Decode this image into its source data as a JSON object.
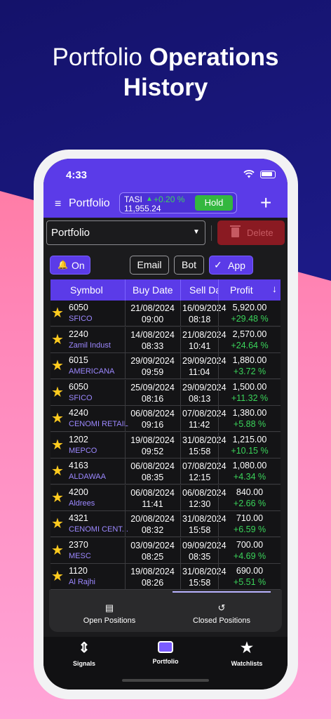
{
  "headline": {
    "light": "Portfolio",
    "bold1": "Operations",
    "bold2": "History"
  },
  "status": {
    "time": "4:33"
  },
  "appbar": {
    "title": "Portfolio",
    "tasi_name": "TASI",
    "tasi_change": "+0.20 %",
    "tasi_value": "11,955.24",
    "hold": "Hold"
  },
  "controls": {
    "portfolio_select": "Portfolio",
    "delete": "Delete",
    "on": "On",
    "email": "Email",
    "bot": "Bot",
    "app": "App"
  },
  "table": {
    "headers": [
      "Symbol",
      "Buy Date",
      "Sell Date",
      "Profit"
    ],
    "rows": [
      {
        "code": "6050",
        "name": "SFICO",
        "buy_date": "21/08/2024",
        "buy_time": "09:00",
        "sell_date": "16/09/2024",
        "sell_time": "08:18",
        "profit": "5,920.00",
        "pct": "+29.48 %"
      },
      {
        "code": "2240",
        "name": "Zamil Indust",
        "buy_date": "14/08/2024",
        "buy_time": "08:33",
        "sell_date": "21/08/2024",
        "sell_time": "10:41",
        "profit": "2,570.00",
        "pct": "+24.64 %"
      },
      {
        "code": "6015",
        "name": "AMERICANA",
        "buy_date": "29/09/2024",
        "buy_time": "09:59",
        "sell_date": "29/09/2024",
        "sell_time": "11:04",
        "profit": "1,880.00",
        "pct": "+3.72 %"
      },
      {
        "code": "6050",
        "name": "SFICO",
        "buy_date": "25/09/2024",
        "buy_time": "08:16",
        "sell_date": "29/09/2024",
        "sell_time": "08:13",
        "profit": "1,500.00",
        "pct": "+11.32 %"
      },
      {
        "code": "4240",
        "name": "CENOMI RETAIL",
        "buy_date": "06/08/2024",
        "buy_time": "09:16",
        "sell_date": "07/08/2024",
        "sell_time": "11:42",
        "profit": "1,380.00",
        "pct": "+5.88 %"
      },
      {
        "code": "1202",
        "name": "MEPCO",
        "buy_date": "19/08/2024",
        "buy_time": "09:52",
        "sell_date": "31/08/2024",
        "sell_time": "15:58",
        "profit": "1,215.00",
        "pct": "+10.15 %"
      },
      {
        "code": "4163",
        "name": "ALDAWAA",
        "buy_date": "06/08/2024",
        "buy_time": "08:35",
        "sell_date": "07/08/2024",
        "sell_time": "12:15",
        "profit": "1,080.00",
        "pct": "+4.34 %"
      },
      {
        "code": "4200",
        "name": "Aldrees",
        "buy_date": "06/08/2024",
        "buy_time": "11:41",
        "sell_date": "06/08/2024",
        "sell_time": "12:30",
        "profit": "840.00",
        "pct": "+2.66 %"
      },
      {
        "code": "4321",
        "name": "CENOMI CENT...",
        "buy_date": "20/08/2024",
        "buy_time": "08:32",
        "sell_date": "31/08/2024",
        "sell_time": "15:58",
        "profit": "710.00",
        "pct": "+6.59 %"
      },
      {
        "code": "2370",
        "name": "MESC",
        "buy_date": "03/09/2024",
        "buy_time": "08:25",
        "sell_date": "09/09/2024",
        "sell_time": "08:35",
        "profit": "700.00",
        "pct": "+4.69 %"
      },
      {
        "code": "1120",
        "name": "Al Rajhi",
        "buy_date": "19/08/2024",
        "buy_time": "08:26",
        "sell_date": "31/08/2024",
        "sell_time": "15:58",
        "profit": "690.00",
        "pct": "+5.51 %"
      }
    ]
  },
  "tabs": {
    "open": "Open Positions",
    "closed": "Closed Positions"
  },
  "nav": {
    "signals": "Signals",
    "portfolio": "Portfolio",
    "watchlists": "Watchlists"
  },
  "colors": {
    "primary": "#5b3be8",
    "positive": "#3ad45a",
    "star": "#ffcb1f",
    "delete": "#8a1a22"
  }
}
